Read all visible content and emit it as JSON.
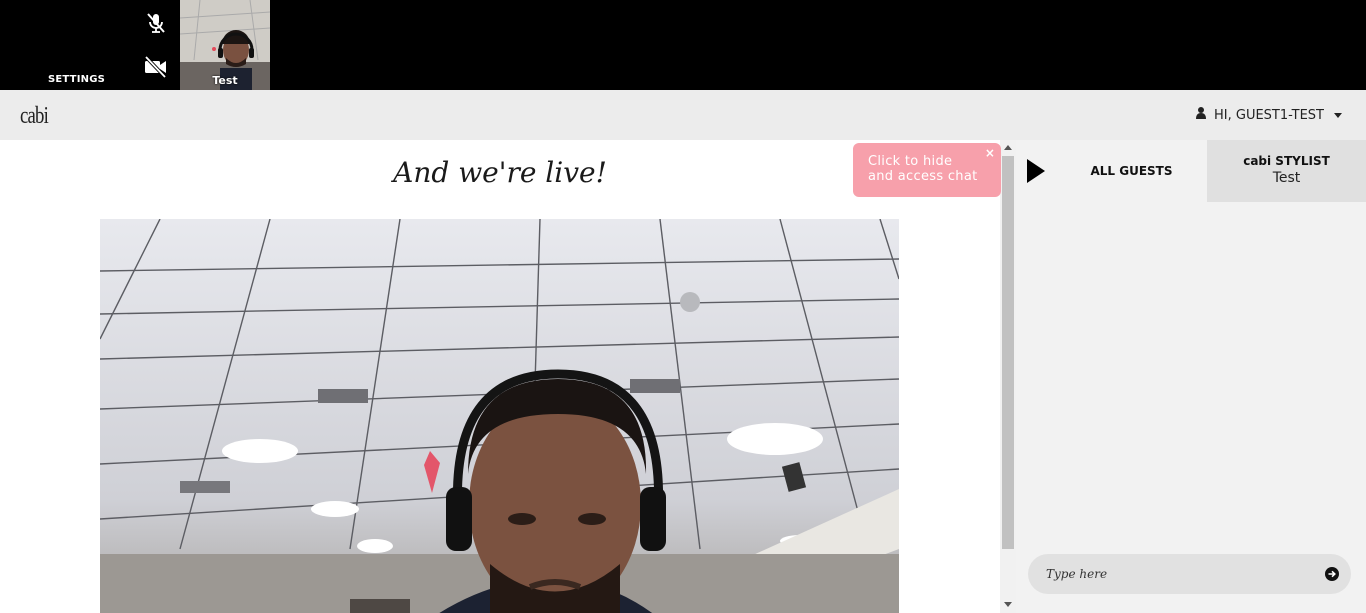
{
  "topbar": {
    "settings_label": "SETTINGS",
    "mic_icon": "mic-muted-icon",
    "camera_icon": "camera-off-icon",
    "self_view_label": "Test"
  },
  "header": {
    "logo": "cabi",
    "user_menu_label": "HI, GUEST1-TEST",
    "user_icon": "user-icon"
  },
  "stage": {
    "title": "And we're live!"
  },
  "chat_tip": {
    "text_line1": "Click to hide",
    "text_line2": "and access chat",
    "close_label": "×"
  },
  "chat": {
    "tab_all_label": "ALL GUESTS",
    "tab_stylist_title": "cabi STYLIST",
    "tab_stylist_name": "Test",
    "input_placeholder": "Type here",
    "send_icon": "arrow-circle-right-icon"
  },
  "colors": {
    "accent_pink": "#f7a0ab",
    "panel_bg": "#f2f2f2",
    "header_bg": "#ececec",
    "topbar_bg": "#000000"
  }
}
